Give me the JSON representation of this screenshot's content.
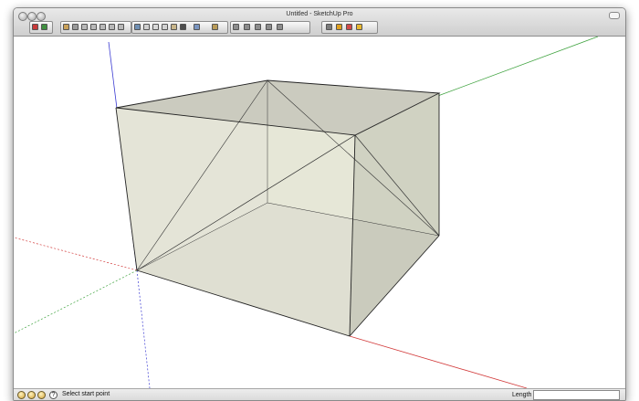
{
  "window": {
    "title": "Untitled - SketchUp Pro"
  },
  "toolbar": {
    "buttons": [
      {
        "name": "getting-started-icon",
        "color": "#c83a3a"
      },
      {
        "name": "model-info-icon",
        "color": "#3f8f3f"
      },
      {
        "name": "walk-icon",
        "color": "#c9a15a"
      },
      {
        "name": "iso-view-icon",
        "color": "#9a9a9a"
      },
      {
        "name": "top-view-icon",
        "color": "#b8b8b8"
      },
      {
        "name": "front-view-icon",
        "color": "#b8b8b8"
      },
      {
        "name": "right-view-icon",
        "color": "#b8b8b8"
      },
      {
        "name": "back-view-icon",
        "color": "#b8b8b8"
      },
      {
        "name": "left-view-icon",
        "color": "#b8b8b8"
      },
      {
        "name": "xray-style-icon",
        "color": "#6f8fb3"
      },
      {
        "name": "wireframe-style-icon",
        "color": "#cfcfcf"
      },
      {
        "name": "hidden-line-style-icon",
        "color": "#d9d9d9"
      },
      {
        "name": "shaded-style-icon",
        "color": "#d2d2d2"
      },
      {
        "name": "shaded-textures-style-icon",
        "color": "#c7b58a"
      },
      {
        "name": "monochrome-style-icon",
        "color": "#4e4e4e"
      },
      {
        "name": "xray-toggle-icon",
        "color": "#7a95c0"
      },
      {
        "name": "section-plane-icon",
        "color": "#b89a58"
      },
      {
        "name": "component-icon",
        "color": "#8c8c8c"
      },
      {
        "name": "group-icon",
        "color": "#8c8c8c"
      },
      {
        "name": "layers-icon",
        "color": "#8c8c8c"
      },
      {
        "name": "outliner-icon",
        "color": "#8c8c8c"
      },
      {
        "name": "scenes-icon",
        "color": "#8c8c8c"
      },
      {
        "name": "orbit-icon",
        "color": "#7c7c7c"
      },
      {
        "name": "paint-bucket-icon",
        "color": "#e0a020"
      },
      {
        "name": "eraser-icon",
        "color": "#d24a4a"
      },
      {
        "name": "warehouse-icon",
        "color": "#e8b830"
      }
    ]
  },
  "canvas": {
    "axis_colors": {
      "red": "#d23a3a",
      "green": "#3fa33f",
      "blue": "#3a3ad2"
    },
    "face_color": "#e4e4d6",
    "edge_color": "#222222"
  },
  "status": {
    "icons": [
      "geo-location-icon",
      "credits-icon",
      "model-author-icon"
    ],
    "help_glyph": "?",
    "message": "Select start point",
    "vcb_label": "Length",
    "vcb_value": ""
  }
}
